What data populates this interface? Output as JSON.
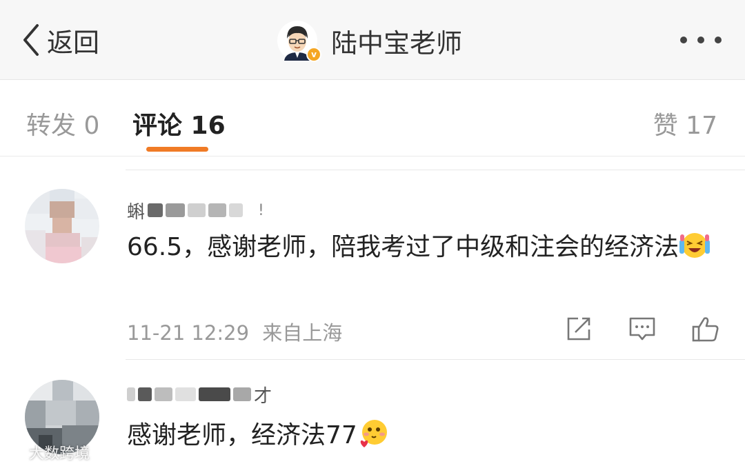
{
  "header": {
    "back_label": "返回",
    "profile_name": "陆中宝老师",
    "verified": true
  },
  "tabs": [
    {
      "label": "转发 0",
      "active": false
    },
    {
      "label": "评论 16",
      "active": true
    },
    {
      "label": "赞 17",
      "active": false
    }
  ],
  "comments": [
    {
      "author": "蝌",
      "author_tail": "!",
      "text": "66.5，感谢老师，陪我考过了中级和注会的经济法",
      "emoji": "laughing-crying-emoji",
      "time": "11-21 12:29",
      "location": "来自上海"
    },
    {
      "author_tail": "才",
      "text": "感谢老师，经济法77",
      "emoji": "blushing-heart-emoji"
    }
  ],
  "watermark": "大数跨境",
  "colors": {
    "accent": "#f07b26",
    "verify": "#f5a623",
    "header_bg": "#f7f7f7"
  }
}
